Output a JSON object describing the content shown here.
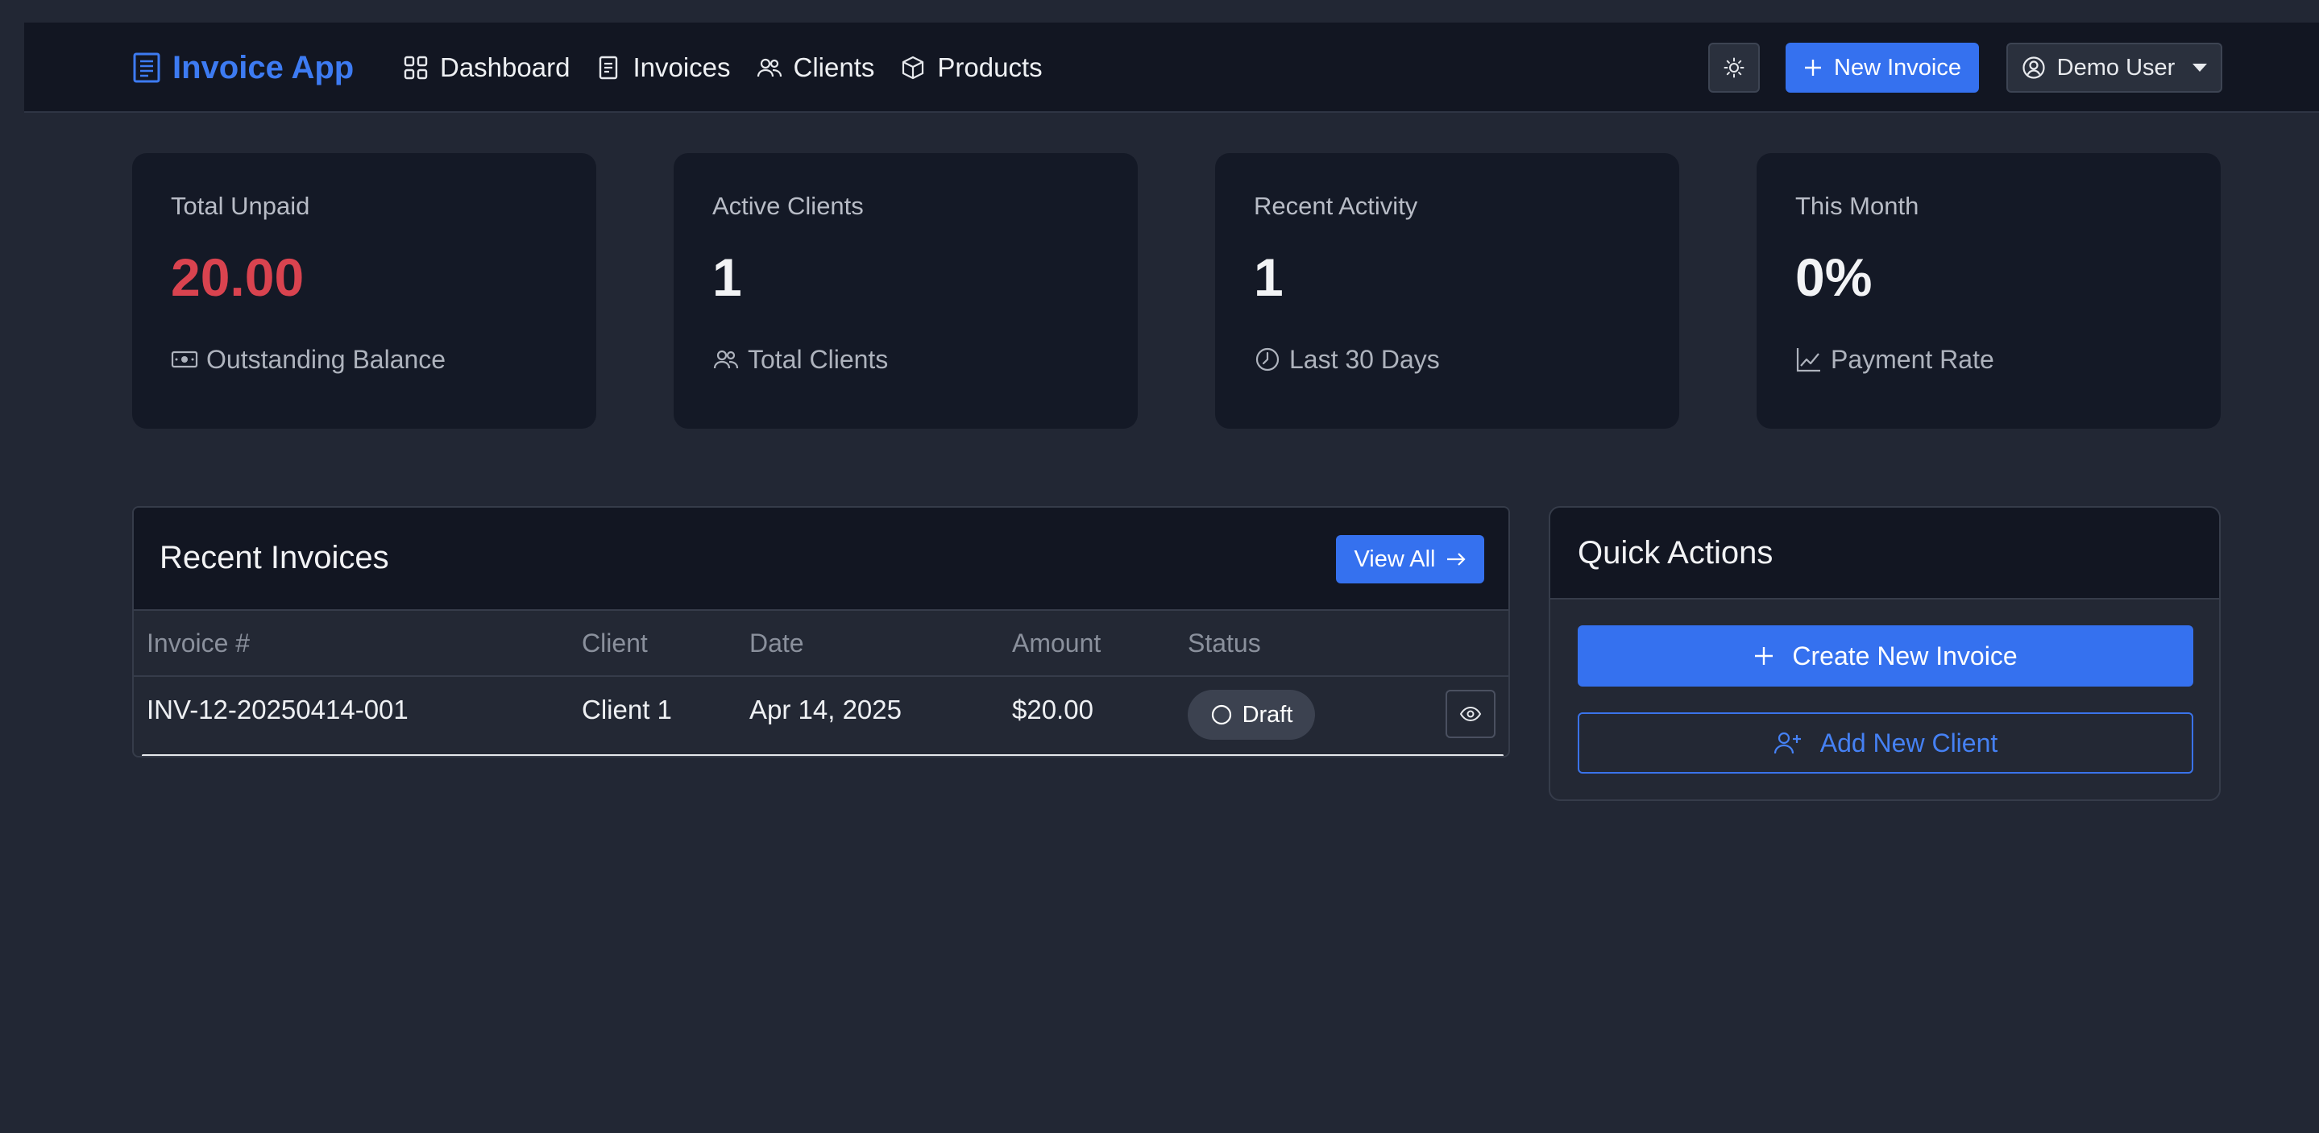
{
  "navbar": {
    "brand": "Invoice App",
    "links": [
      {
        "label": "Dashboard",
        "icon": "grid-icon"
      },
      {
        "label": "Invoices",
        "icon": "document-icon"
      },
      {
        "label": "Clients",
        "icon": "people-icon"
      },
      {
        "label": "Products",
        "icon": "box-icon"
      }
    ],
    "new_invoice_label": "New Invoice",
    "user_label": "Demo User"
  },
  "stats": [
    {
      "label": "Total Unpaid",
      "value": "20.00",
      "sub": "Outstanding Balance",
      "icon": "cash-icon"
    },
    {
      "label": "Active Clients",
      "value": "1",
      "sub": "Total Clients",
      "icon": "people-icon"
    },
    {
      "label": "Recent Activity",
      "value": "1",
      "sub": "Last 30 Days",
      "icon": "clock-icon"
    },
    {
      "label": "This Month",
      "value": "0%",
      "sub": "Payment Rate",
      "icon": "chart-line-icon"
    }
  ],
  "recent_invoices": {
    "title": "Recent Invoices",
    "view_all_label": "View All",
    "columns": [
      "Invoice #",
      "Client",
      "Date",
      "Amount",
      "Status"
    ],
    "rows": [
      {
        "invoice": "INV-12-20250414-001",
        "client": "Client 1",
        "date": "Apr 14, 2025",
        "amount": "$20.00",
        "status": "Draft"
      }
    ]
  },
  "quick_actions": {
    "title": "Quick Actions",
    "create_label": "Create New Invoice",
    "add_client_label": "Add New Client"
  },
  "colors": {
    "accent": "#3571ef",
    "danger": "#d9434f",
    "background": "#222734",
    "card": "#141926"
  }
}
